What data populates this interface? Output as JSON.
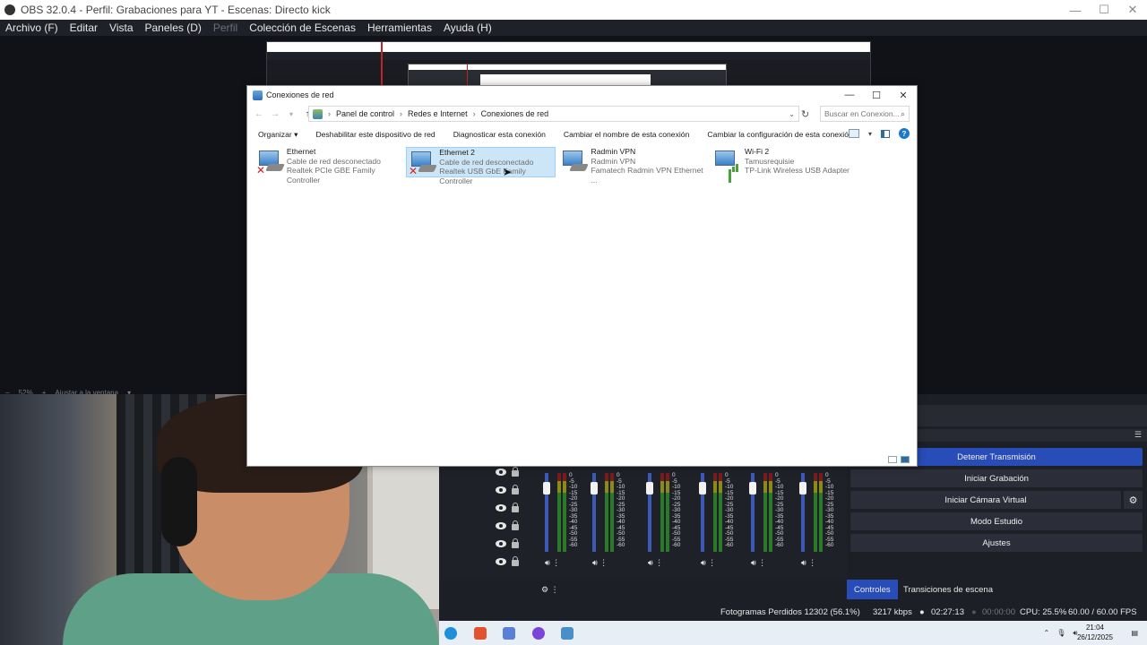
{
  "obs": {
    "title": "OBS 32.0.4 - Perfil: Grabaciones para YT - Escenas: Directo kick",
    "menu": [
      "Archivo (F)",
      "Editar",
      "Vista",
      "Paneles (D)",
      "Perfil",
      "Colección de Escenas",
      "Herramientas",
      "Ayuda (H)"
    ],
    "zoom": "52%",
    "fit_label": "Ajustar a la ventana",
    "controls": {
      "stop_stream": "Detener Transmisión",
      "start_recording": "Iniciar Grabación",
      "start_virtualcam": "Iniciar Cámara Virtual",
      "studio_mode": "Modo Estudio",
      "settings": "Ajustes"
    },
    "dock_tabs": [
      "Controles",
      "Transiciones de escena"
    ],
    "meter_scale": [
      "0",
      "-5",
      "-10",
      "-15",
      "-20",
      "-25",
      "-30",
      "-35",
      "-40",
      "-45",
      "-50",
      "-55",
      "-60"
    ],
    "status": {
      "dropped": "Fotogramas Perdidos 12302 (56.1%)",
      "bitrate": "3217 kbps",
      "stream_time": "02:27:13",
      "rec_time": "00:00:00",
      "cpu": "CPU: 25.5%",
      "fps": "60.00 / 60.00 FPS"
    }
  },
  "explorer": {
    "title": "Conexiones de red",
    "breadcrumb": [
      "Panel de control",
      "Redes e Internet",
      "Conexiones de red"
    ],
    "search_placeholder": "Buscar en Conexion...",
    "commands": [
      "Organizar",
      "Deshabilitar este dispositivo de red",
      "Diagnosticar esta conexión",
      "Cambiar el nombre de esta conexión",
      "Cambiar la configuración de esta conexión"
    ],
    "adapters": [
      {
        "name": "Ethernet",
        "status": "Cable de red desconectado",
        "device": "Realtek PCIe GBE Family Controller",
        "disconnected": true,
        "selected": false
      },
      {
        "name": "Ethernet 2",
        "status": "Cable de red desconectado",
        "device": "Realtek USB GbE Family Controller",
        "disconnected": true,
        "selected": true
      },
      {
        "name": "Radmin VPN",
        "status": "Radmin VPN",
        "device": "Famatech Radmin VPN Ethernet ...",
        "disconnected": false,
        "selected": false
      },
      {
        "name": "Wi-Fi 2",
        "status": "Tamusrequisie",
        "device": "TP-Link Wireless USB Adapter",
        "disconnected": false,
        "selected": false,
        "wifi": true
      }
    ]
  },
  "taskbar": {
    "time": "21:04",
    "date": "26/12/2025"
  }
}
